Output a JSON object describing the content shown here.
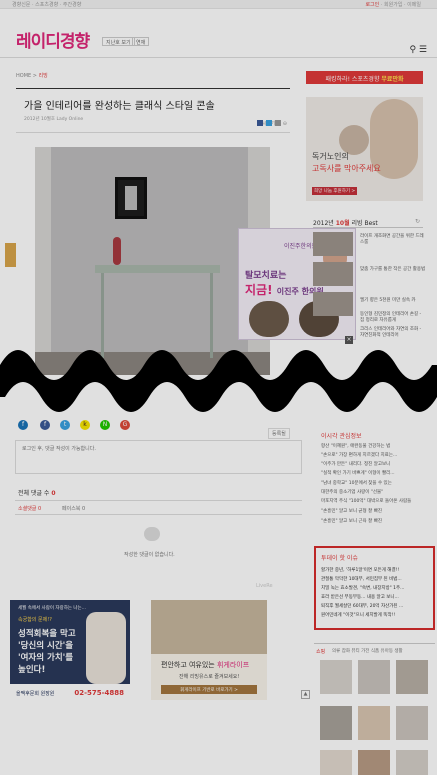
{
  "topbar": {
    "left": "경향신문 · 스포츠경향 · 주간경향",
    "login": "로그인",
    "right": " · 회원가입 · 이메일"
  },
  "header": {
    "logo": "레이디경향",
    "sub1": "지난호 보기",
    "sub2": "연재"
  },
  "breadcrumb": {
    "home": "HOME",
    "section": "리빙"
  },
  "article": {
    "title": "가을 인테리어를 완성하는 클래식 스타일 콘솔",
    "meta": "2012년 10월호 Lady Online",
    "font_label": "글씨크기"
  },
  "popup_ad": {
    "clinic": "이진주한의원",
    "headline": "탈모치료는",
    "headline2": "지금!",
    "doctor": "이진주 한의원"
  },
  "right_banner": {
    "text": "패킹하라! 스포츠경향",
    "accent": "무료만화"
  },
  "right_ad": {
    "line1": "독거노인의",
    "line2": "고독사를 막아주세요",
    "cta": "희망 나눔 후원하기 >"
  },
  "best": {
    "year_label": "2012년",
    "month": "10월",
    "suffix": " 리빙 Best",
    "items": [
      "라이프 개조화면 공간을 위한 드레스룸",
      "맞춤 가구를 통한 작은 공간 활용법",
      "엘기 향은 5천원 미만 실속 카",
      "동인형 김민정의 인테리어 손길 - 집 정리로 자유롭게",
      "크리스 인테리어와 자연의 조화 - 자연친화적 인테리어"
    ]
  },
  "popular": {
    "title": "이시각 관심정보",
    "items": [
      "항산 \"이혜원\", 애완동물 건강하는 법",
      "\"손으로\" 가장 편하게 지르겠다 치료는...",
      "\"이주가 만든\" 내리다. 정진 알고보니",
      "\"실적 확인 가기 바쁘게\" 이형이 빨리...",
      "\"남녀 중학교\" 10분에서 찾을 수 있는",
      "대한주의 중소기업 사랑이 \"선물\"",
      "마포지역 주식 \"100억\" 대박으로 돌아온 사람들",
      "\"손흥민\" 알고 보니 균형 잘 빠진",
      "\"손흥민\" 알고 보니 근육 잘 빠진"
    ]
  },
  "today_issue": {
    "title": "투데이 핫 이슈",
    "items": [
      "할가한 중년, '하루1알'이면 모든게 해결!!",
      "관절통 막막한 10대부, 서민집부 된 비법...",
      "치밀 녹는 효소발견, \"숙변, 내장지방\" 1주...",
      "효라 받은선 부동부동... 내용 알고 보니...",
      "퇴직후 월세살던 60대부, 20억 자산가된 ...",
      "원어민네게 \"이것\"으니 세치발게 뚝깍!!"
    ]
  },
  "shopping": {
    "label": "쇼핑",
    "tabs": "의류  잡화  뷰티  가전  식품  유아동  생활"
  },
  "comments": {
    "btn": "등록될",
    "placeholder": "로그인 후, 댓글 작성이 가능합니다.",
    "count_label": "전체 댓글 수",
    "count": "0",
    "tab1": "소셜댓글 0",
    "tab2": "페이스북 0",
    "empty": "작성한 댓글이 없습니다.",
    "livere": "LiveRe"
  },
  "ad_left": {
    "top": "세월 속에서 사람이 자랑하는 나는...",
    "sub": "속궁합의 문제!?",
    "headline": "성적회복을 막고 '당신의 시간'을 '여자의 가치'를 높인다!",
    "clinic": "을맥후문회 원장원",
    "phone": "02-575-4888"
  },
  "ad_right": {
    "headline_a": "편안하고 여유있는 ",
    "headline_b": "휘게라이프",
    "sub": "잔해 리빙유스로 즐겨보세요!",
    "cta": "휘게라이프 기반로 바로가기 >"
  },
  "sns_icons": [
    "facebook-icon",
    "twitter-icon",
    "kakao-icon",
    "naver-icon",
    "google-plus-icon"
  ]
}
